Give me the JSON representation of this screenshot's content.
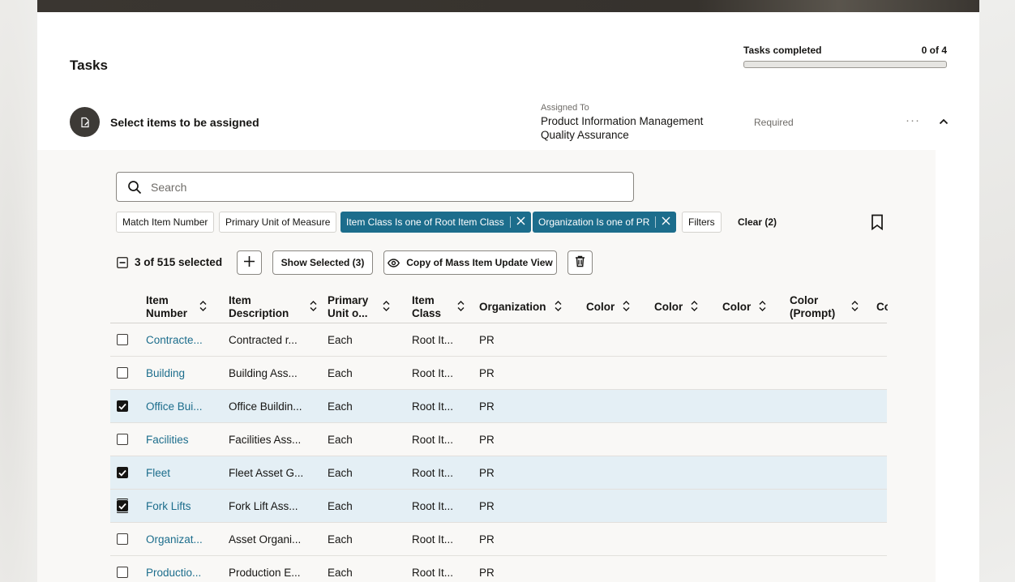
{
  "header": {
    "title": "Tasks",
    "progress_label": "Tasks completed",
    "progress_count": "0 of 4",
    "progress_fraction": 0
  },
  "task": {
    "name": "Select items to be assigned",
    "assigned_label": "Assigned To",
    "assigned_value": "Product Information Management Quality Assurance",
    "status": "Required",
    "more_label": "···"
  },
  "search": {
    "placeholder": "Search"
  },
  "filters": {
    "chips": [
      {
        "label": "Match Item Number",
        "active": false
      },
      {
        "label": "Primary Unit of Measure",
        "active": false
      },
      {
        "label": "Item Class Is one of Root Item Class",
        "active": true
      },
      {
        "label": "Organization Is one of PR",
        "active": true
      },
      {
        "label": "Filters",
        "active": false
      }
    ],
    "clear_label": "Clear (2)"
  },
  "toolbar": {
    "selection_text": "3 of 515 selected",
    "show_selected_label": "Show Selected (3)",
    "view_label": "Copy of Mass Item Update View"
  },
  "table": {
    "columns": [
      "Item Number",
      "Item Description",
      "Primary Unit o...",
      "Item Class",
      "Organization",
      "Color",
      "Color",
      "Color",
      "Color (Prompt)",
      "Cc"
    ],
    "rows": [
      {
        "item_number": "Contracte...",
        "description": "Contracted r...",
        "uom": "Each",
        "item_class": "Root It...",
        "organization": "PR",
        "selected": false
      },
      {
        "item_number": "Building",
        "description": "Building Ass...",
        "uom": "Each",
        "item_class": "Root It...",
        "organization": "PR",
        "selected": false
      },
      {
        "item_number": "Office Bui...",
        "description": "Office Buildin...",
        "uom": "Each",
        "item_class": "Root It...",
        "organization": "PR",
        "selected": true
      },
      {
        "item_number": "Facilities",
        "description": "Facilities Ass...",
        "uom": "Each",
        "item_class": "Root It...",
        "organization": "PR",
        "selected": false
      },
      {
        "item_number": "Fleet",
        "description": "Fleet Asset G...",
        "uom": "Each",
        "item_class": "Root It...",
        "organization": "PR",
        "selected": true
      },
      {
        "item_number": "Fork Lifts",
        "description": "Fork Lift Ass...",
        "uom": "Each",
        "item_class": "Root It...",
        "organization": "PR",
        "selected": true
      },
      {
        "item_number": "Organizat...",
        "description": "Asset Organi...",
        "uom": "Each",
        "item_class": "Root It...",
        "organization": "PR",
        "selected": false
      },
      {
        "item_number": "Productio...",
        "description": "Production E...",
        "uom": "Each",
        "item_class": "Root It...",
        "organization": "PR",
        "selected": false
      }
    ]
  },
  "colors": {
    "accent": "#1c6d8c",
    "link": "#1c6d8c",
    "selected_row": "#e4eff5",
    "panel_bg": "#f9f8f6"
  },
  "icons": {
    "task": "document-edit-icon",
    "search": "search-icon",
    "remove_chip": "close-icon",
    "bookmark": "bookmark-icon",
    "add": "plus-icon",
    "view": "eye-icon",
    "delete": "trash-icon",
    "sort": "sort-icon",
    "collapse": "chevron-up-icon"
  }
}
